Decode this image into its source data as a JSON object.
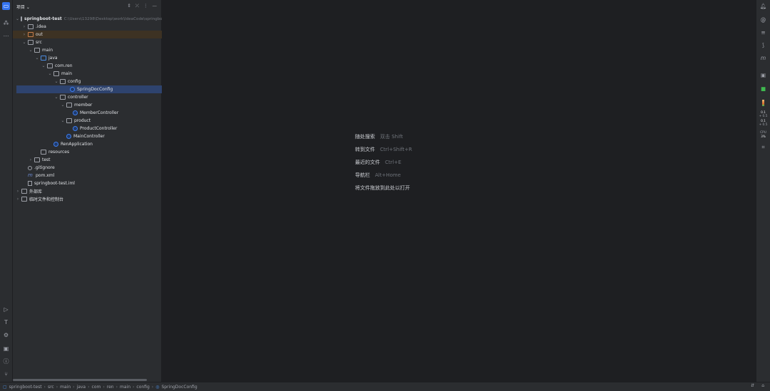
{
  "project_panel": {
    "title": "项目 ⌄",
    "tools": [
      "⇕",
      "⤫",
      "⋮",
      "—"
    ],
    "root": {
      "name": "springboot-test",
      "path": "C:\\Users\\13298\\Desktop\\work\\IdeaCode\\springboo"
    },
    "tree": [
      {
        "label": ".idea"
      },
      {
        "label": "out"
      },
      {
        "label": "src"
      },
      {
        "label": "main"
      },
      {
        "label": "java"
      },
      {
        "label": "com.ren"
      },
      {
        "label": "main"
      },
      {
        "label": "config"
      },
      {
        "label": "SpringDocConfig"
      },
      {
        "label": "controller"
      },
      {
        "label": "member"
      },
      {
        "label": "MemberController"
      },
      {
        "label": "product"
      },
      {
        "label": "ProductController"
      },
      {
        "label": "MainController"
      },
      {
        "label": "RenApplication"
      },
      {
        "label": "resources"
      },
      {
        "label": "test"
      },
      {
        "label": ".gitignore"
      },
      {
        "label": "pom.xml"
      },
      {
        "label": "springboot-test.iml"
      },
      {
        "label": "外部库"
      },
      {
        "label": "临时文件和控制台"
      }
    ]
  },
  "editor_hints": [
    {
      "action": "随处搜索",
      "key": "双击 Shift"
    },
    {
      "action": "转到文件",
      "key": "Ctrl+Shift+R"
    },
    {
      "action": "最近的文件",
      "key": "Ctrl+E"
    },
    {
      "action": "导航栏",
      "key": "Alt+Home"
    },
    {
      "action": "将文件拖放到此处以打开",
      "key": ""
    }
  ],
  "right_toolbar": {
    "memory": {
      "a": "0.1",
      "a_unit": "+ 0.5",
      "b": "0.1",
      "b_unit": "+ 0.5",
      "cpu_label": "CPU",
      "cpu_value": "3%"
    }
  },
  "status_bar": {
    "breadcrumb": [
      "springboot-test",
      "src",
      "main",
      "java",
      "com",
      "ren",
      "main",
      "config",
      "SpringDocConfig"
    ]
  },
  "colors": {
    "accent": "#3574f0",
    "selection": "#2e436e",
    "excluded": "#3d3223",
    "background": "#1e1f22",
    "panel": "#2b2d30"
  }
}
